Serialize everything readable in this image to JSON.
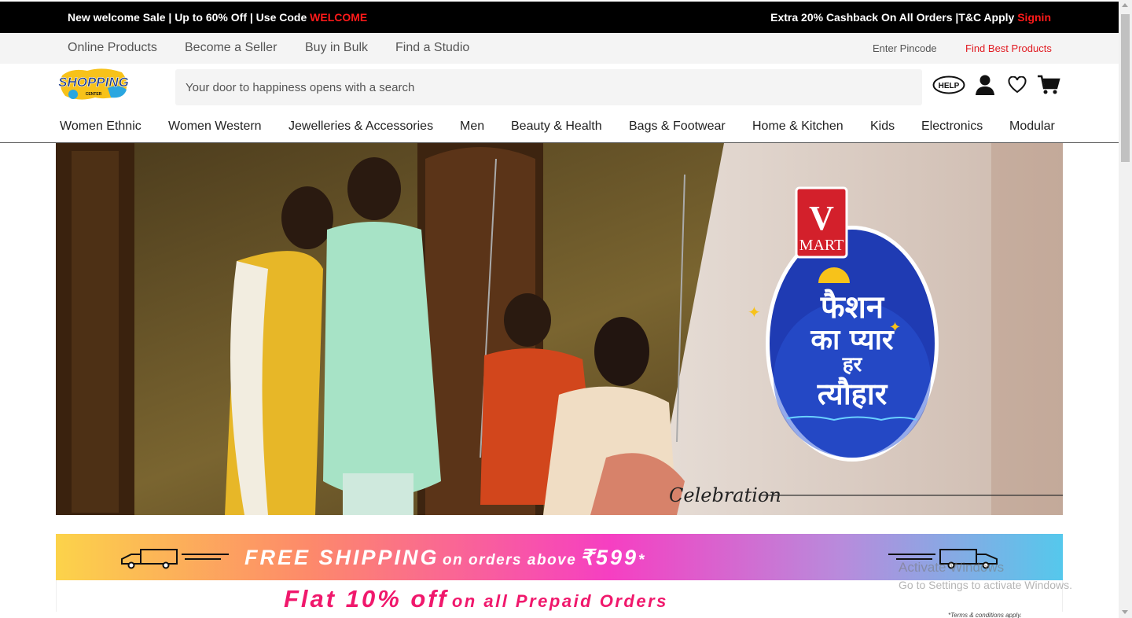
{
  "promo_bar": {
    "left_text": "New welcome Sale | Up to 60% Off | Use Code ",
    "left_code": "WELCOME",
    "right_text": "Extra 20% Cashback On All Orders |T&C Apply ",
    "right_link": "Signin"
  },
  "sub_nav": {
    "links": [
      "Online Products",
      "Become a Seller",
      "Buy in Bulk",
      "Find a Studio"
    ],
    "pincode_label": "Enter Pincode",
    "best_products_label": "Find Best Products"
  },
  "header": {
    "logo_text": "SHOPPING",
    "logo_sub": "CENTER",
    "search_placeholder": "Your door to happiness opens with a search",
    "help_label": "HELP",
    "icons": [
      "help-icon",
      "user-icon",
      "heart-icon",
      "cart-icon"
    ]
  },
  "categories": [
    "Women Ethnic",
    "Women Western",
    "Jewelleries & Accessories",
    "Men",
    "Beauty & Health",
    "Bags & Footwear",
    "Home & Kitchen",
    "Kids",
    "Electronics",
    "Modular"
  ],
  "banner": {
    "brand_v": "V",
    "brand_mart": "MART",
    "hindi_line1": "फैशन",
    "hindi_line2": "का प्यार",
    "hindi_line3": "हर",
    "hindi_line4": "त्यौहार",
    "script_text": "Celebration"
  },
  "shipping_strip": {
    "free_shipping": "FREE SHIPPING",
    "on_orders": "on orders above",
    "amount": "₹599",
    "asterisk": "*"
  },
  "offer_strip": {
    "flat_off": "Flat 10% off",
    "prepaid": "on all Prepaid Orders",
    "terms": "*Terms & conditions apply."
  },
  "os_watermark": {
    "line1": "Activate Windows",
    "line2": "Go to Settings to activate Windows."
  },
  "colors": {
    "promo_bg": "#000000",
    "accent_red": "#e11b22",
    "flat_pink": "#f0186c",
    "vmart_blue": "#1f3bb3",
    "vmart_red": "#d3202b"
  }
}
